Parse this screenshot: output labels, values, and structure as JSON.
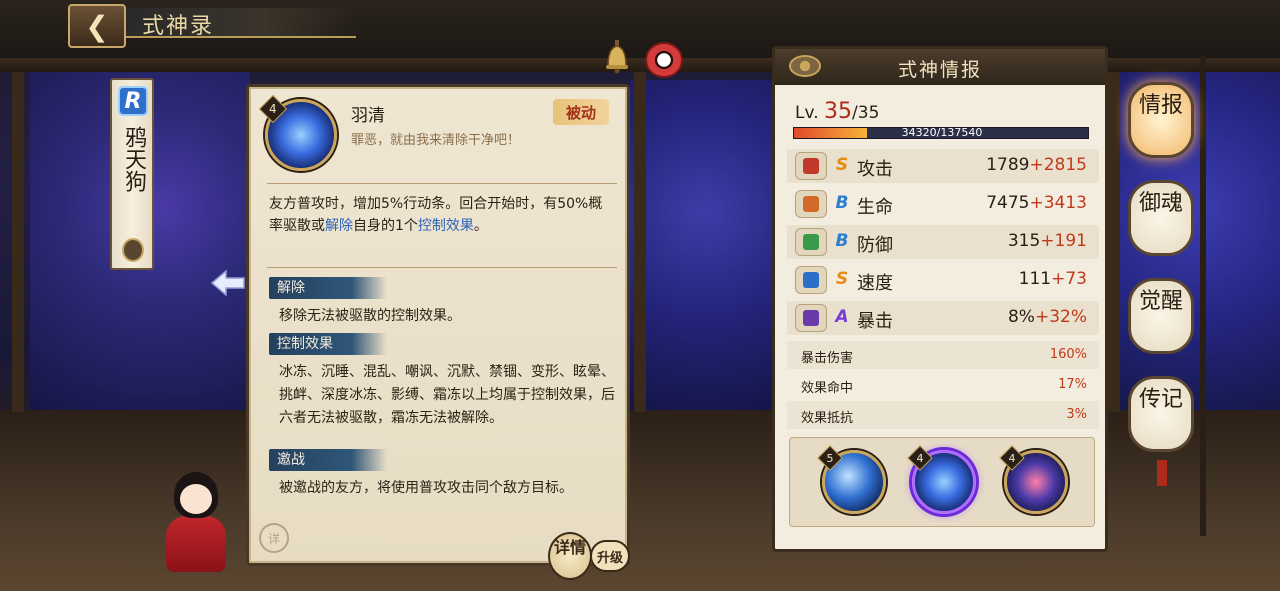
{
  "header": {
    "back_icon": "back-arrow-icon",
    "title": "式神录"
  },
  "shikigami": {
    "rarity": "R",
    "name": "鸦天狗"
  },
  "skill_panel": {
    "level": "4",
    "name": "羽清",
    "quote": "罪恶，就由我来清除干净吧！",
    "type_tag": "被动",
    "desc_part1": "友方普攻时，增加5%行动条。回合开始时，有50%概率驱散或",
    "desc_kw1": "解除",
    "desc_part2": "自身的1个",
    "desc_kw2": "控制效果",
    "desc_part3": "。",
    "keywords": [
      {
        "tag": "解除",
        "text": "移除无法被驱散的控制效果。"
      },
      {
        "tag": "控制效果",
        "text": "冰冻、沉睡、混乱、嘲讽、沉默、禁锢、变形、眩晕、挑衅、深度冰冻、影缚、霜冻以上均属于控制效果，后六者无法被驱散，霜冻无法被解除。"
      },
      {
        "tag": "邀战",
        "text": "被邀战的友方，将使用普攻攻击同个敌方目标。"
      }
    ],
    "seal": "详",
    "detail_button": "详情",
    "upgrade_button": "升级"
  },
  "info_panel": {
    "title": "式神情报",
    "level_prefix": "Lv.",
    "level": "35",
    "level_max": "/35",
    "exp_text": "34320/137540",
    "exp_fraction": 0.2495,
    "stats": [
      {
        "name": "攻击",
        "grade": "S",
        "base": "1789",
        "bonus": "+2815",
        "icon": "attack-icon",
        "color": "#c0392b"
      },
      {
        "name": "生命",
        "grade": "B",
        "base": "7475",
        "bonus": "+3413",
        "icon": "health-icon",
        "color": "#d36a2a"
      },
      {
        "name": "防御",
        "grade": "B",
        "base": "315",
        "bonus": "+191",
        "icon": "defense-icon",
        "color": "#3a9a4a"
      },
      {
        "name": "速度",
        "grade": "S",
        "base": "111",
        "bonus": "+73",
        "icon": "speed-icon",
        "color": "#2b6fc9"
      },
      {
        "name": "暴击",
        "grade": "A",
        "base": "8%",
        "bonus": "+32%",
        "icon": "crit-icon",
        "color": "#6a3aa8"
      }
    ],
    "sub_stats": [
      {
        "name": "暴击伤害",
        "value": "160%"
      },
      {
        "name": "效果命中",
        "value": "17%"
      },
      {
        "name": "效果抵抗",
        "value": "3%"
      }
    ],
    "skills": [
      {
        "level": "5",
        "icon": "wind-slash-skill-icon"
      },
      {
        "level": "4",
        "icon": "feather-cleanse-skill-icon"
      },
      {
        "level": "4",
        "icon": "dark-tengu-skill-icon"
      }
    ]
  },
  "side_nav": [
    "情报",
    "御魂",
    "觉醒",
    "传记"
  ]
}
